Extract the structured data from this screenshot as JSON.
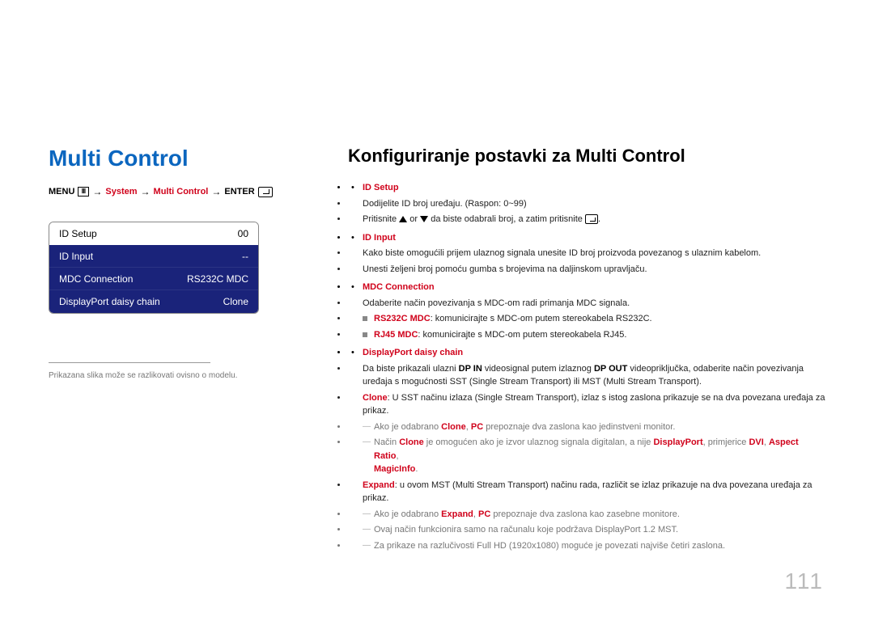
{
  "left": {
    "title": "Multi Control",
    "breadcrumb": {
      "menu": "MENU",
      "path1": "System",
      "path2": "Multi Control",
      "enter": "ENTER"
    },
    "menu": [
      {
        "label": "ID Setup",
        "value": "00",
        "selected": true
      },
      {
        "label": "ID Input",
        "value": "--",
        "selected": false
      },
      {
        "label": "MDC Connection",
        "value": "RS232C MDC",
        "selected": false
      },
      {
        "label": "DisplayPort daisy chain",
        "value": "Clone",
        "selected": false
      }
    ],
    "footnote": "Prikazana slika može se razlikovati ovisno o modelu."
  },
  "right": {
    "title": "Konfiguriranje postavki za Multi Control",
    "idsetup": {
      "head": "ID Setup",
      "l1": "Dodijelite ID broj uređaju. (Raspon: 0~99)",
      "l2a": "Pritisnite ",
      "l2b": " or ",
      "l2c": " da biste odabrali broj, a zatim pritisnite ",
      "l2d": "."
    },
    "idinput": {
      "head": "ID Input",
      "l1": "Kako biste omogućili prijem ulaznog signala unesite ID broj proizvoda povezanog s ulaznim kabelom.",
      "l2": "Unesti željeni broj pomoću gumba s brojevima na daljinskom upravljaču."
    },
    "mdc": {
      "head": "MDC Connection",
      "l1": "Odaberite način povezivanja s MDC-om radi primanja MDC signala.",
      "opt1_head": "RS232C MDC",
      "opt1_tail": ": komunicirajte s MDC-om putem stereokabela RS232C.",
      "opt2_head": "RJ45 MDC",
      "opt2_tail": ": komunicirajte s MDC-om putem stereokabela RJ45."
    },
    "dp": {
      "head": "DisplayPort daisy chain",
      "l1a": "Da biste prikazali ulazni ",
      "l1b": "DP IN",
      "l1c": " videosignal putem izlaznog ",
      "l1d": "DP OUT",
      "l1e": " videopriključka, odaberite način povezivanja uređaja s mogućnosti SST (Single Stream Transport) ili MST (Multi Stream Transport).",
      "clone_head": "Clone",
      "clone_tail": ": U SST načinu izlaza (Single Stream Transport), izlaz s istog zaslona prikazuje se na dva povezana uređaja za prikaz.",
      "n1a": "Ako je odabrano ",
      "n1b": "Clone",
      "n1c": ", ",
      "n1d": "PC",
      "n1e": " prepoznaje dva zaslona kao jedinstveni monitor.",
      "n2a": "Način ",
      "n2b": "Clone",
      "n2c": " je omogućen ako je izvor ulaznog signala digitalan, a nije ",
      "n2d": "DisplayPort",
      "n2e": ", primjerice ",
      "n2f": "DVI",
      "n2g": ", ",
      "n2h": "Aspect Ratio",
      "n2i": ", ",
      "n2j": "MagicInfo",
      "n2k": ".",
      "expand_head": "Expand",
      "expand_tail": ": u ovom MST (Multi Stream Transport) načinu rada, različit se izlaz prikazuje na dva povezana uređaja za prikaz.",
      "n3a": "Ako je odabrano ",
      "n3b": "Expand",
      "n3c": ", ",
      "n3d": "PC",
      "n3e": " prepoznaje dva zaslona kao zasebne monitore.",
      "n4": "Ovaj način funkcionira samo na računalu koje podržava DisplayPort 1.2 MST.",
      "n5": "Za prikaze na razlučivosti Full HD (1920x1080) moguće je povezati najviše četiri zaslona."
    }
  },
  "page_number": "111"
}
